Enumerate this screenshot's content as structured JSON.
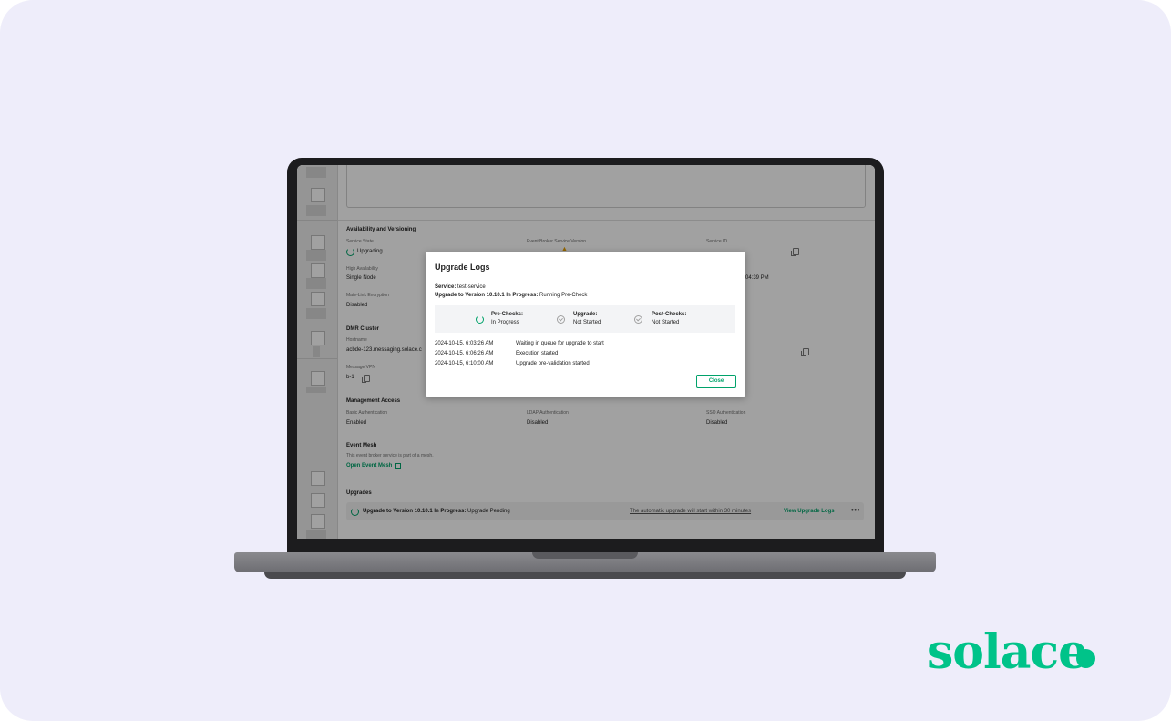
{
  "brand": {
    "logo_text": "solace",
    "accent": "#00c389"
  },
  "sections": {
    "availability": {
      "title": "Availability and Versioning",
      "service_state_label": "Service State",
      "service_state_value": "Upgrading",
      "broker_version_label": "Event Broker Service Version",
      "service_id_label": "Service ID",
      "high_availability_label": "High Availability",
      "high_availability_value": "Single Node",
      "time_value": "04:39 PM",
      "encryption_label": "Mate-Link Encryption",
      "encryption_value": "Disabled"
    },
    "dmr": {
      "title": "DMR Cluster",
      "hostname_label": "Hostname",
      "hostname_value": "acbde-123.messaging.solace.c",
      "vpn_label": "Message VPN",
      "vpn_value": "b-1"
    },
    "management": {
      "title": "Management Access",
      "basic_label": "Basic Authentication",
      "basic_value": "Enabled",
      "ldap_label": "LDAP Authentication",
      "ldap_value": "Disabled",
      "sso_label": "SSO Authentication",
      "sso_value": "Disabled"
    },
    "mesh": {
      "title": "Event Mesh",
      "description": "This event broker service is part of a mesh.",
      "link": "Open Event Mesh"
    },
    "upgrades": {
      "title": "Upgrades",
      "status_bold": "Upgrade to Version 10.10.1 In Progress:",
      "status_text": "Upgrade Pending",
      "auto_note": "The automatic upgrade will start within 30 minutes",
      "view_logs": "View Upgrade Logs",
      "more": "•••"
    }
  },
  "modal": {
    "title": "Upgrade Logs",
    "service_label": "Service:",
    "service_value": "test-service",
    "progress_label": "Upgrade to Version 10.10.1 In Progress:",
    "progress_value": "Running Pre-Check",
    "steps": [
      {
        "title": "Pre-Checks:",
        "status": "In Progress"
      },
      {
        "title": "Upgrade:",
        "status": "Not Started"
      },
      {
        "title": "Post-Checks:",
        "status": "Not Started"
      }
    ],
    "logs": [
      {
        "time": "2024-10-15, 6:03:26 AM",
        "message": "Waiting in queue for upgrade to start"
      },
      {
        "time": "2024-10-15, 6:06:26 AM",
        "message": "Execution started"
      },
      {
        "time": "2024-10-15, 6:10:00 AM",
        "message": "Upgrade pre-validation started"
      }
    ],
    "close_label": "Close"
  }
}
